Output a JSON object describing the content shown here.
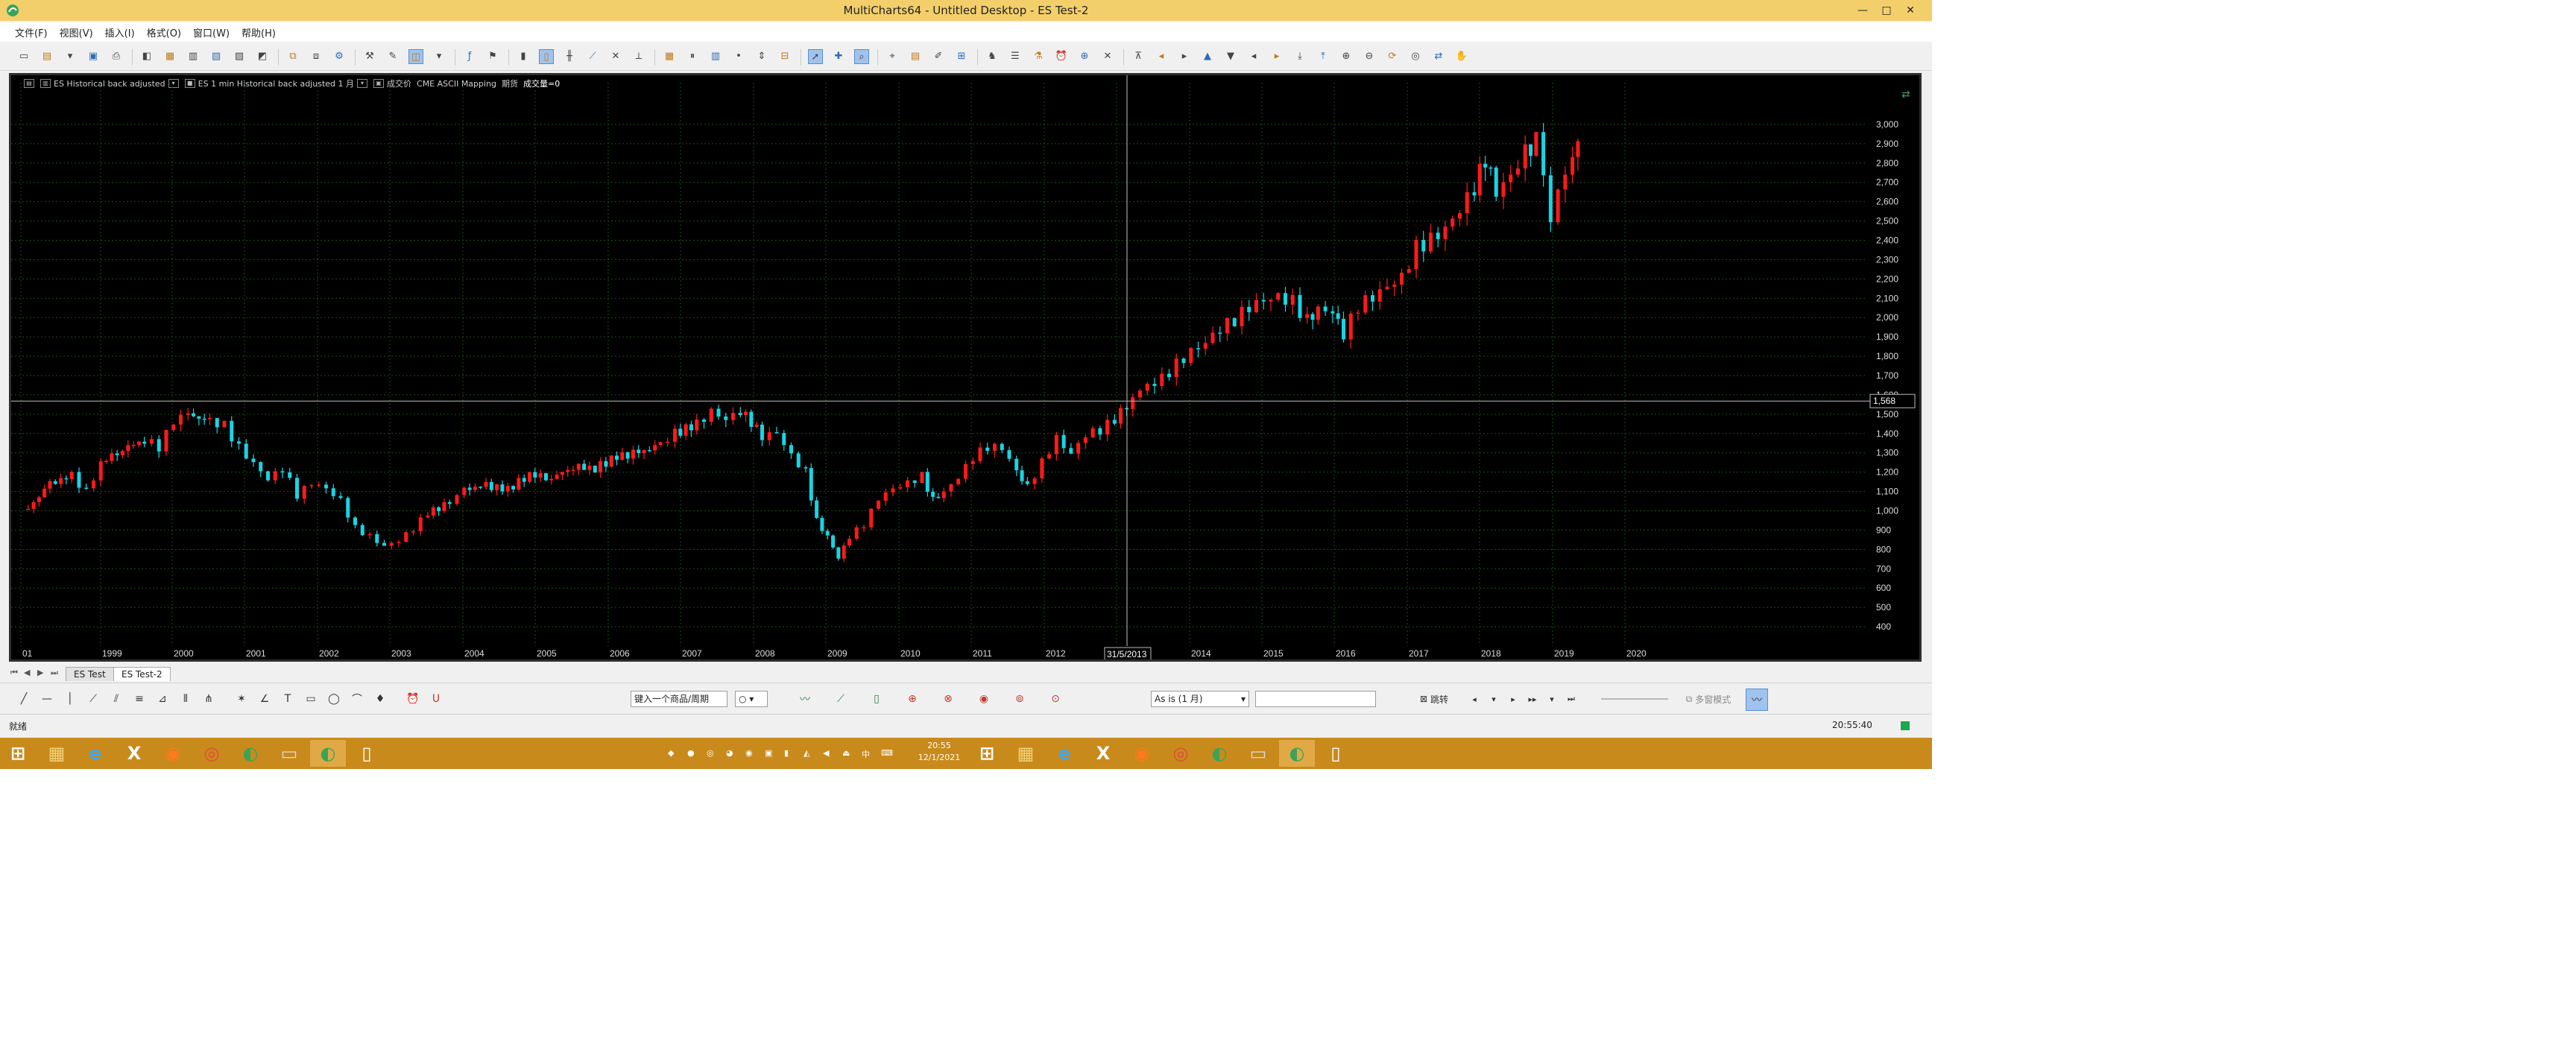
{
  "window": {
    "title": "MultiCharts64 - Untitled Desktop - ES Test-2",
    "min": "—",
    "max": "□",
    "close": "✕"
  },
  "menu": [
    "文件(F)",
    "视图(V)",
    "插入(I)",
    "格式(O)",
    "窗口(W)",
    "帮助(H)"
  ],
  "chart_header": {
    "symbol1": "ES Historical back adjusted",
    "symbol2": "ES 1 min Historical back adjusted",
    "interval": "1 月",
    "volume_label": "成交价",
    "feed": "CME",
    "source": "ASCII Mapping",
    "type_label": "期货",
    "volume_value": "成交量=0"
  },
  "crosshair": {
    "date_label": "31/5/2013",
    "price_label": "1,568"
  },
  "chart_data": {
    "type": "candlestick",
    "x_label": "",
    "y_label": "",
    "ylim": [
      300,
      3100
    ],
    "y_ticks": [
      3000,
      2900,
      2800,
      2700,
      2600,
      2500,
      2400,
      2300,
      2200,
      2100,
      2000,
      1900,
      1800,
      1700,
      1600,
      1500,
      1400,
      1300,
      1200,
      1100,
      1000,
      900,
      800,
      700,
      600,
      500,
      400
    ],
    "y_tick_labels": [
      "3,000",
      "2,900",
      "2,800",
      "2,700",
      "2,600",
      "2,500",
      "2,400",
      "2,300",
      "2,200",
      "2,100",
      "2,000",
      "1,900",
      "1,800",
      "1,700",
      "1,600",
      "1,500",
      "1,400",
      "1,300",
      "1,200",
      "1,100",
      "1,000",
      "900",
      "800",
      "700",
      "600",
      "500",
      "400"
    ],
    "x_tick_labels": [
      "01",
      "1999",
      "2000",
      "2001",
      "2002",
      "2003",
      "2004",
      "2005",
      "2006",
      "2007",
      "2008",
      "2009",
      "2010",
      "2011",
      "2012",
      "2013",
      "2014",
      "2015",
      "2016",
      "2017",
      "2018",
      "2019",
      "2020"
    ],
    "x_first_year": 1998.0,
    "x_last_year": 2020.0,
    "series_close_monthly": [
      [
        1998.0,
        1010
      ],
      [
        1998.3,
        1140
      ],
      [
        1998.6,
        1180
      ],
      [
        1998.8,
        1100
      ],
      [
        1999.0,
        1250
      ],
      [
        1999.3,
        1320
      ],
      [
        1999.6,
        1370
      ],
      [
        1999.8,
        1330
      ],
      [
        2000.0,
        1460
      ],
      [
        2000.2,
        1500
      ],
      [
        2000.5,
        1460
      ],
      [
        2000.7,
        1440
      ],
      [
        2000.9,
        1330
      ],
      [
        2001.1,
        1250
      ],
      [
        2001.3,
        1170
      ],
      [
        2001.5,
        1220
      ],
      [
        2001.7,
        1080
      ],
      [
        2001.9,
        1140
      ],
      [
        2002.1,
        1110
      ],
      [
        2002.3,
        1050
      ],
      [
        2002.5,
        910
      ],
      [
        2002.7,
        870
      ],
      [
        2002.9,
        820
      ],
      [
        2003.1,
        850
      ],
      [
        2003.3,
        910
      ],
      [
        2003.5,
        990
      ],
      [
        2003.8,
        1040
      ],
      [
        2004.0,
        1110
      ],
      [
        2004.3,
        1130
      ],
      [
        2004.6,
        1110
      ],
      [
        2004.9,
        1190
      ],
      [
        2005.2,
        1170
      ],
      [
        2005.5,
        1230
      ],
      [
        2005.8,
        1220
      ],
      [
        2006.1,
        1280
      ],
      [
        2006.4,
        1300
      ],
      [
        2006.7,
        1340
      ],
      [
        2006.9,
        1400
      ],
      [
        2007.2,
        1450
      ],
      [
        2007.4,
        1520
      ],
      [
        2007.6,
        1480
      ],
      [
        2007.8,
        1520
      ],
      [
        2007.95,
        1460
      ],
      [
        2008.1,
        1380
      ],
      [
        2008.3,
        1400
      ],
      [
        2008.5,
        1280
      ],
      [
        2008.7,
        1200
      ],
      [
        2008.85,
        950
      ],
      [
        2009.0,
        870
      ],
      [
        2009.15,
        760
      ],
      [
        2009.3,
        870
      ],
      [
        2009.5,
        930
      ],
      [
        2009.7,
        1060
      ],
      [
        2009.9,
        1110
      ],
      [
        2010.1,
        1140
      ],
      [
        2010.3,
        1180
      ],
      [
        2010.45,
        1060
      ],
      [
        2010.6,
        1100
      ],
      [
        2010.8,
        1180
      ],
      [
        2011.0,
        1280
      ],
      [
        2011.2,
        1330
      ],
      [
        2011.4,
        1320
      ],
      [
        2011.6,
        1200
      ],
      [
        2011.75,
        1120
      ],
      [
        2011.95,
        1250
      ],
      [
        2012.15,
        1380
      ],
      [
        2012.35,
        1300
      ],
      [
        2012.55,
        1400
      ],
      [
        2012.75,
        1420
      ],
      [
        2012.95,
        1470
      ],
      [
        2013.2,
        1590
      ],
      [
        2013.4,
        1640
      ],
      [
        2013.6,
        1680
      ],
      [
        2013.8,
        1760
      ],
      [
        2014.0,
        1830
      ],
      [
        2014.2,
        1880
      ],
      [
        2014.4,
        1950
      ],
      [
        2014.6,
        1990
      ],
      [
        2014.8,
        2050
      ],
      [
        2015.0,
        2080
      ],
      [
        2015.2,
        2100
      ],
      [
        2015.4,
        2080
      ],
      [
        2015.6,
        1990
      ],
      [
        2015.75,
        2050
      ],
      [
        2015.95,
        2040
      ],
      [
        2016.1,
        1920
      ],
      [
        2016.3,
        2060
      ],
      [
        2016.5,
        2100
      ],
      [
        2016.7,
        2150
      ],
      [
        2016.9,
        2200
      ],
      [
        2017.1,
        2360
      ],
      [
        2017.3,
        2410
      ],
      [
        2017.5,
        2470
      ],
      [
        2017.7,
        2570
      ],
      [
        2017.9,
        2680
      ],
      [
        2018.05,
        2820
      ],
      [
        2018.2,
        2640
      ],
      [
        2018.4,
        2720
      ],
      [
        2018.6,
        2850
      ],
      [
        2018.75,
        2910
      ],
      [
        2018.85,
        2710
      ],
      [
        2018.95,
        2500
      ],
      [
        2019.05,
        2700
      ],
      [
        2019.15,
        2790
      ],
      [
        2019.25,
        2870
      ]
    ]
  },
  "tabs": [
    "ES Test",
    "ES Test-2"
  ],
  "drawbar": {
    "symbol_placeholder": "键入一个商品/周期",
    "resolution_select": "As is (1 月)",
    "text_field": "",
    "jump_label": "跳转",
    "multi_mode_label": "多窗模式"
  },
  "status": {
    "left": "就绪",
    "time": "20:55:40"
  },
  "taskbar": {
    "clock_time": "20:55",
    "clock_date": "12/1/2021"
  },
  "colors": {
    "up_candle": "#ff1a1a",
    "down_candle": "#19d4e3",
    "grid": "#1d4a1d",
    "axis_text": "#dcdcdc",
    "crosshair": "#bfbfbf",
    "taskbar": "#c98a1c",
    "title_bar": "#f3cf6b"
  },
  "icons": {
    "toolbar": [
      "new-workspace-icon",
      "open-icon",
      "open-dropdown-icon",
      "save-icon",
      "print-icon",
      "new-chart-icon",
      "new-scanner-icon",
      "new-dom-icon",
      "new-portfolio-icon",
      "new-order-icon",
      "new-alert-icon",
      "attach-window-icon",
      "detach-window-icon",
      "format-instrument-icon",
      "format-study-icon",
      "format-drawing-icon",
      "chart-type-icon",
      "chart-type-dropdown",
      "insert-study-icon",
      "insert-signal-icon",
      "bar-chart-icon",
      "candlestick-icon",
      "ohlc-icon",
      "line-chart-icon",
      "point-figure-icon",
      "kagi-icon",
      "renko-icon",
      "linebreak-icon",
      "volume-icon",
      "tick-icon",
      "scale-icon",
      "overlay-icon",
      "pointer-icon",
      "crosshair-icon",
      "zoom-icon",
      "zoom-area-icon",
      "data-window-icon",
      "drawing-icon",
      "order-entry-icon",
      "strategy-icon",
      "perf-report-icon",
      "optimize-icon",
      "alert-icon",
      "calc-icon",
      "expand-icon",
      "collapse-icon",
      "shift-left-icon",
      "shift-right-icon",
      "up-icon",
      "down-icon",
      "left-icon",
      "right-icon",
      "auto-scroll-icon",
      "reset-scale-icon",
      "zoom-in-icon",
      "zoom-out-icon",
      "refresh-icon",
      "magnet-icon",
      "sync-icon",
      "hand-icon"
    ],
    "draw": [
      "trendline-icon",
      "horizontal-line-icon",
      "vertical-line-icon",
      "ray-icon",
      "parallel-icon",
      "fib-retracement-icon",
      "fib-extension-icon",
      "fib-time-icon",
      "andrew-icon",
      "gann-icon",
      "regression-icon",
      "text-icon",
      "rectangle-icon",
      "ellipse-icon",
      "arc-icon",
      "marker-icon",
      "alarm-icon",
      "underline-icon"
    ]
  }
}
